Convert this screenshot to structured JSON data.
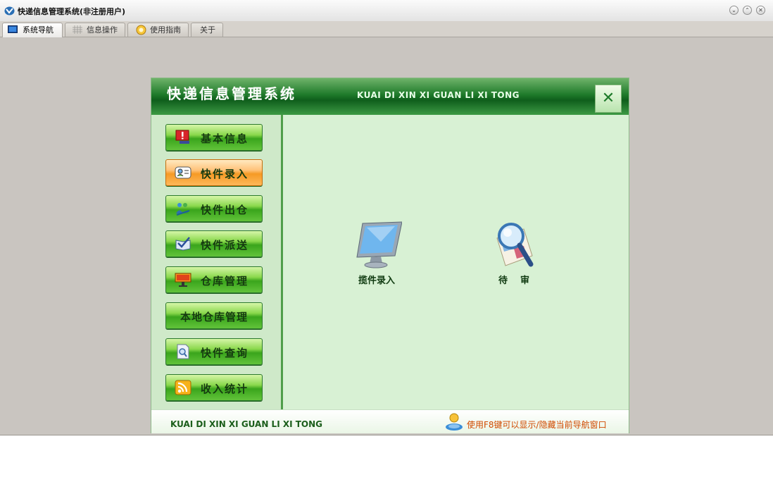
{
  "window": {
    "title": "快递信息管理系统(非注册用户)",
    "controls": [
      "minimize",
      "restore",
      "close"
    ]
  },
  "tabs": [
    {
      "label": "系统导航",
      "icon": "monitor-icon",
      "active": true
    },
    {
      "label": "信息操作",
      "icon": "grid-icon",
      "active": false
    },
    {
      "label": "使用指南",
      "icon": "help-icon",
      "active": false
    },
    {
      "label": "关于",
      "icon": "",
      "active": false
    }
  ],
  "panel": {
    "title": "快递信息管理系统",
    "subtitle_pinyin": "KUAI DI XIN XI GUAN LI XI TONG",
    "close_glyph": "✕",
    "nav": [
      {
        "label": "基本信息",
        "icon": "alert-screen-icon",
        "active": false
      },
      {
        "label": "快件录入",
        "icon": "contact-card-icon",
        "active": true
      },
      {
        "label": "快件出仓",
        "icon": "people-arrow-icon",
        "active": false
      },
      {
        "label": "快件派送",
        "icon": "book-check-icon",
        "active": false
      },
      {
        "label": "仓库管理",
        "icon": "presentation-icon",
        "active": false
      },
      {
        "label": "本地仓库管理",
        "icon": "",
        "active": false
      },
      {
        "label": "快件查询",
        "icon": "document-search-icon",
        "active": false
      },
      {
        "label": "收入统计",
        "icon": "rss-icon",
        "active": false
      }
    ],
    "items": [
      {
        "label": "揽件录入",
        "icon": "monitor-icon"
      },
      {
        "label": "待    审",
        "icon": "magnifier-icon"
      }
    ],
    "footer": {
      "left": "KUAI DI XIN XI GUAN LI XI TONG",
      "hint": "使用F8键可以显示/隐藏当前导航窗口"
    }
  },
  "colors": {
    "header_green": "#1e7a2a",
    "panel_bg": "#d8f0d4",
    "active_orange": "#f59a25",
    "hint_text": "#d04a00"
  }
}
